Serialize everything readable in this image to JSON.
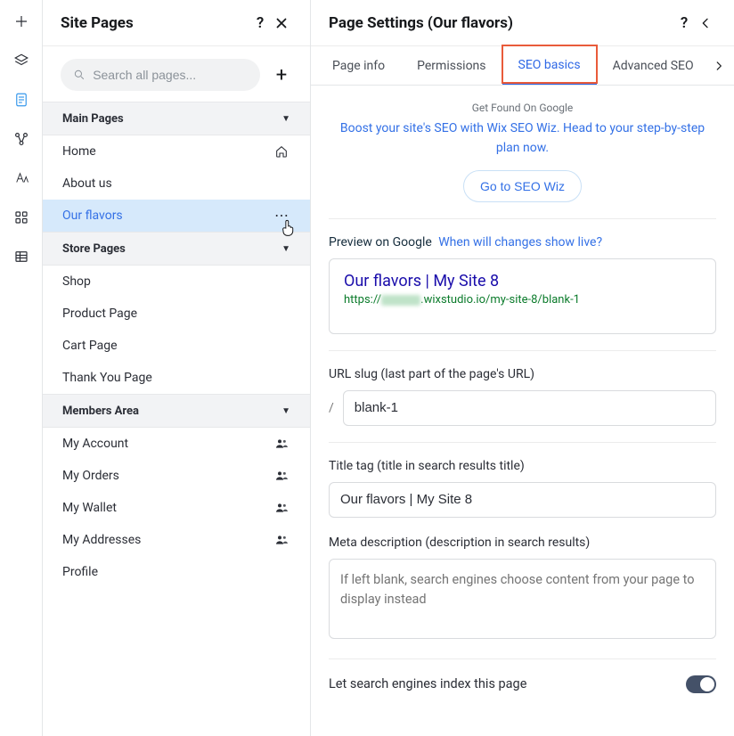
{
  "rail": {
    "items": [
      "add",
      "layers",
      "page",
      "connect",
      "text",
      "apps",
      "data"
    ]
  },
  "pagesPanel": {
    "title": "Site Pages",
    "searchPlaceholder": "Search all pages...",
    "sections": [
      {
        "title": "Main Pages",
        "items": [
          {
            "label": "Home",
            "trailing": "home-icon"
          },
          {
            "label": "About us"
          },
          {
            "label": "Our flavors",
            "selected": true,
            "trailing": "more-icon"
          }
        ]
      },
      {
        "title": "Store Pages",
        "items": [
          {
            "label": "Shop"
          },
          {
            "label": "Product Page"
          },
          {
            "label": "Cart Page"
          },
          {
            "label": "Thank You Page"
          }
        ]
      },
      {
        "title": "Members Area",
        "items": [
          {
            "label": "My Account",
            "trailing": "members-icon"
          },
          {
            "label": "My Orders",
            "trailing": "members-icon"
          },
          {
            "label": "My Wallet",
            "trailing": "members-icon"
          },
          {
            "label": "My Addresses",
            "trailing": "members-icon"
          },
          {
            "label": "Profile"
          }
        ]
      }
    ]
  },
  "settings": {
    "title": "Page Settings (Our flavors)",
    "tabs": {
      "pageInfo": "Page info",
      "permissions": "Permissions",
      "seoBasics": "SEO basics",
      "advancedSeo": "Advanced SEO"
    },
    "promo": {
      "kicker": "Get Found On Google",
      "text": "Boost your site's SEO with Wix SEO Wiz. Head to your step-by-step plan now.",
      "cta": "Go to SEO Wiz"
    },
    "preview": {
      "label": "Preview on Google",
      "liveLink": "When will changes show live?",
      "title": "Our flavors | My Site 8",
      "urlPrefix": "https://",
      "urlSuffix": ".wixstudio.io/my-site-8/blank-1"
    },
    "slug": {
      "label": "URL slug (last part of the page's URL)",
      "value": "blank-1"
    },
    "titleTag": {
      "label": "Title tag (title in search results title)",
      "value": "Our flavors | My Site 8"
    },
    "metaDesc": {
      "label": "Meta description (description in search results)",
      "placeholder": "If left blank, search engines choose content from your page to display instead"
    },
    "indexToggle": {
      "label": "Let search engines index this page",
      "value": true
    }
  }
}
